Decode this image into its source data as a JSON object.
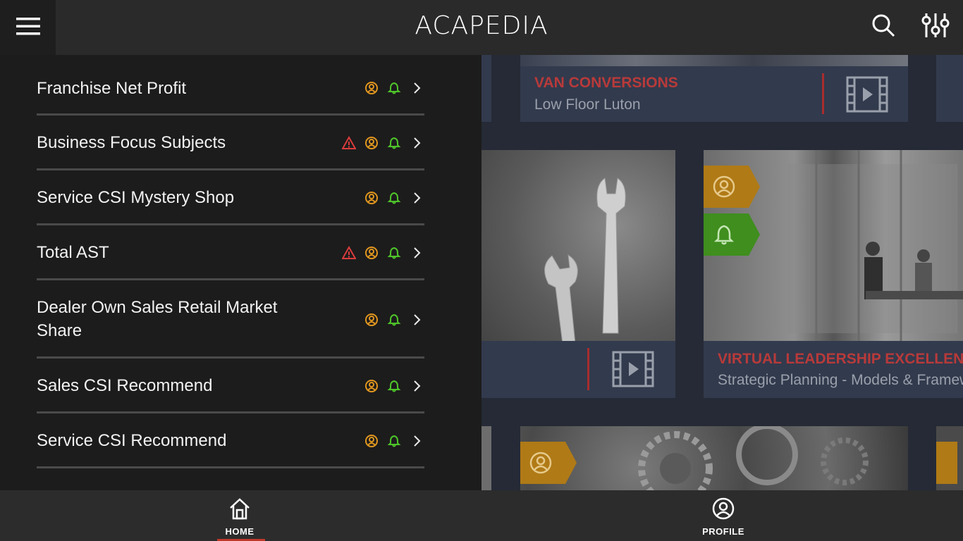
{
  "app": {
    "title": "ACAPEDIA"
  },
  "colors": {
    "orange": "#e0961f",
    "green": "#4ec22a",
    "red": "#d93c3c",
    "caption_title": "#b83a3a"
  },
  "menu_items": [
    {
      "label": "Franchise Net Profit",
      "warning": false
    },
    {
      "label": "Business Focus Subjects",
      "warning": true
    },
    {
      "label": "Service CSI Mystery Shop",
      "warning": false
    },
    {
      "label": "Total AST",
      "warning": true
    },
    {
      "label": "Dealer Own Sales Retail Market Share",
      "warning": false
    },
    {
      "label": "Sales CSI Recommend",
      "warning": false
    },
    {
      "label": "Service CSI Recommend",
      "warning": false
    }
  ],
  "cards": [
    {
      "title": "VAN CONVERSIONS",
      "subtitle": "Low Floor Luton"
    },
    {
      "title": "VIRTUAL LEADERSHIP EXCELLENCE",
      "subtitle": "Strategic Planning - Models & Frameworks"
    }
  ],
  "bottom_nav": {
    "home": "HOME",
    "profile": "PROFILE"
  }
}
